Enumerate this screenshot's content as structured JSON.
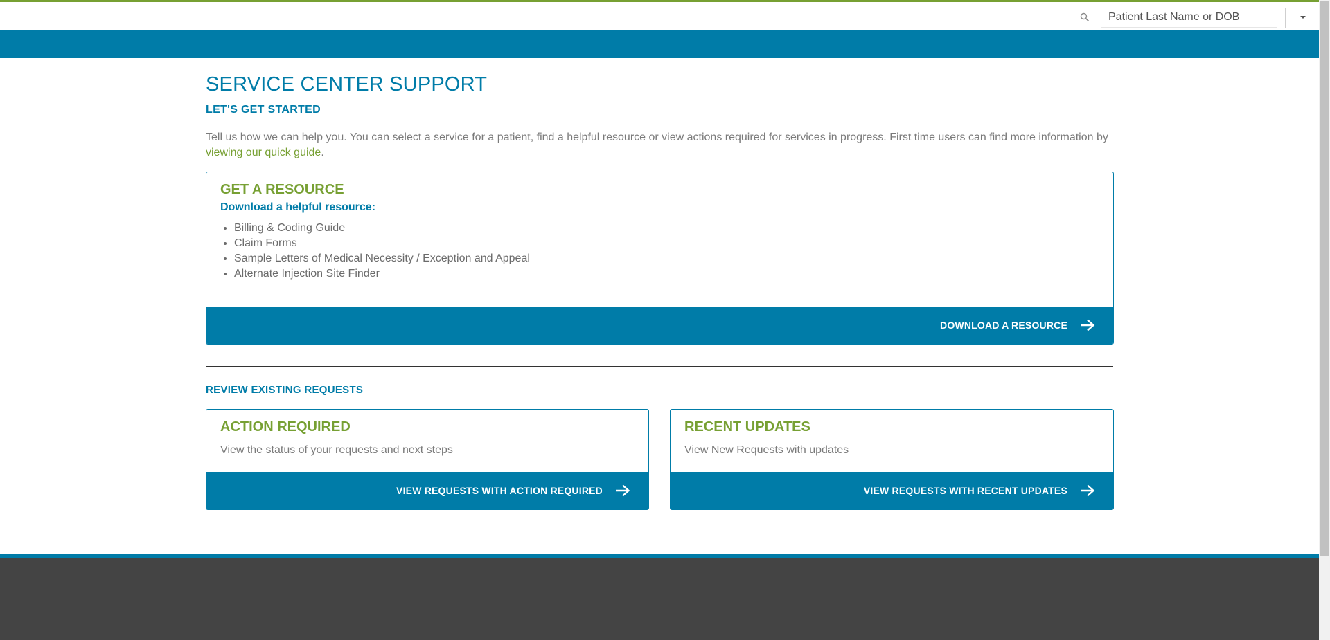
{
  "header": {
    "search_placeholder": "Patient Last Name or DOB"
  },
  "page": {
    "title": "SERVICE CENTER SUPPORT",
    "subtitle": "LET'S GET STARTED",
    "intro_text": "Tell us how we can help you. You can select a service for a patient, find a helpful resource or view actions required for services in progress. First time users can find more information by",
    "intro_link": "viewing our quick guide",
    "intro_end": "."
  },
  "resource_card": {
    "title": "GET A RESOURCE",
    "subtitle": "Download a helpful resource:",
    "items": [
      "Billing & Coding Guide",
      "Claim Forms",
      "Sample Letters of Medical Necessity / Exception and Appeal",
      "Alternate Injection Site Finder"
    ],
    "action_label": "DOWNLOAD A RESOURCE"
  },
  "review": {
    "heading": "REVIEW EXISTING REQUESTS",
    "action_required": {
      "title": "ACTION REQUIRED",
      "text": "View the status of your requests and next steps",
      "action_label": "VIEW REQUESTS WITH ACTION REQUIRED"
    },
    "recent_updates": {
      "title": "RECENT UPDATES",
      "text": "View New Requests with updates",
      "action_label": "VIEW REQUESTS WITH RECENT UPDATES"
    }
  },
  "colors": {
    "primary_blue": "#007ca8",
    "accent_green": "#77a033",
    "footer_gray": "#444444"
  },
  "icons": {
    "search": "search-icon",
    "dropdown": "chevron-down-icon",
    "action_arrow": "arrow-right-icon"
  }
}
